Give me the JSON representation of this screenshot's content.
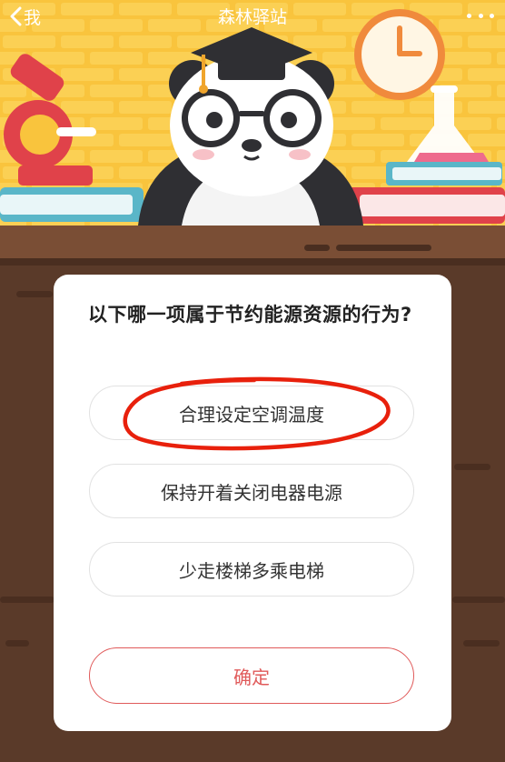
{
  "nav": {
    "back_label": "我",
    "title": "森林驿站"
  },
  "quiz": {
    "question": "以下哪一项属于节约能源资源的行为?",
    "options": [
      "合理设定空调温度",
      "保持开着关闭电器电源",
      "少走楼梯多乘电梯"
    ],
    "confirm_label": "确定",
    "marked_option": "合理设定空调温度"
  },
  "colors": {
    "accent": "#e05a5a",
    "marker": "#e8200c",
    "background_top": "#f9c43d",
    "wood": "#5a3a29"
  }
}
